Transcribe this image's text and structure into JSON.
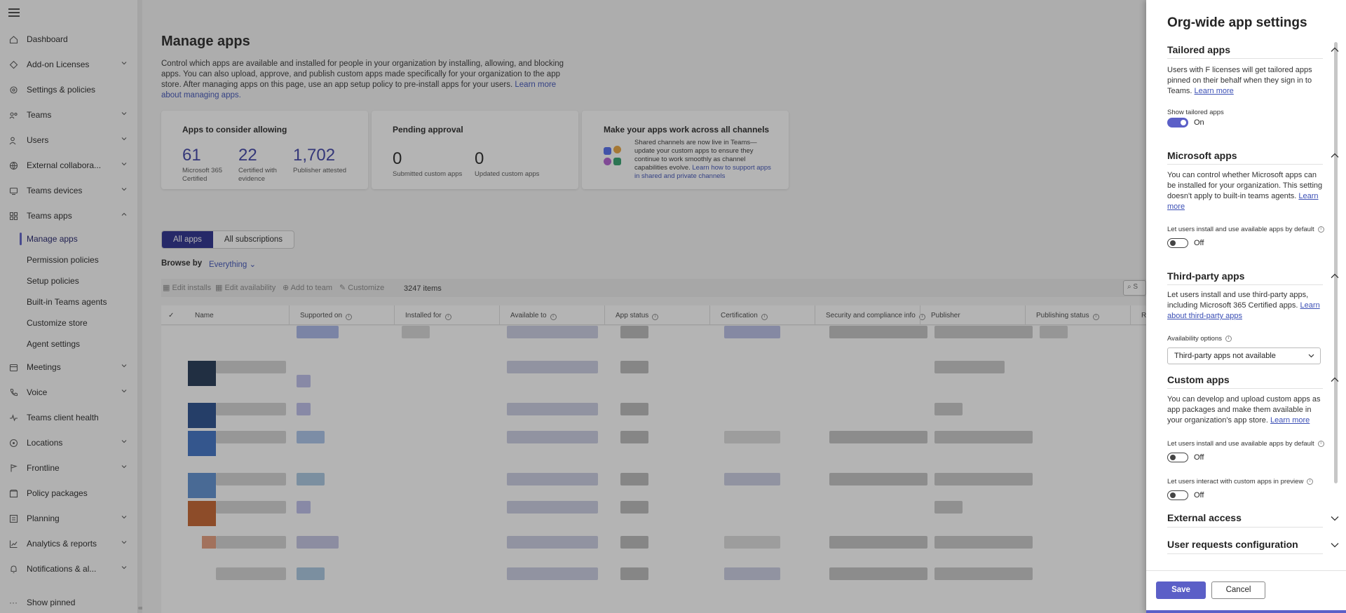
{
  "nav": {
    "items": [
      {
        "label": "Dashboard",
        "icon": "home-icon",
        "chevron": false
      },
      {
        "label": "Add-on Licenses",
        "icon": "diamond-icon",
        "chevron": true
      },
      {
        "label": "Settings & policies",
        "icon": "gear-icon",
        "chevron": false
      },
      {
        "label": "Teams",
        "icon": "teams-icon",
        "chevron": true
      },
      {
        "label": "Users",
        "icon": "users-icon",
        "chevron": true
      },
      {
        "label": "External collabora...",
        "icon": "globe-icon",
        "chevron": true
      },
      {
        "label": "Teams devices",
        "icon": "devices-icon",
        "chevron": true
      },
      {
        "label": "Teams apps",
        "icon": "apps-icon",
        "chevron": true
      }
    ],
    "sub_items": [
      "Manage apps",
      "Permission policies",
      "Setup policies",
      "Built-in Teams agents",
      "Customize store",
      "Agent settings"
    ],
    "items_after": [
      {
        "label": "Meetings",
        "icon": "calendar-icon"
      },
      {
        "label": "Voice",
        "icon": "phone-icon"
      },
      {
        "label": "Teams client health",
        "icon": "pulse-icon"
      },
      {
        "label": "Locations",
        "icon": "location-icon"
      },
      {
        "label": "Frontline",
        "icon": "frontline-icon"
      },
      {
        "label": "Policy packages",
        "icon": "package-icon"
      },
      {
        "label": "Planning",
        "icon": "planning-icon"
      },
      {
        "label": "Analytics & reports",
        "icon": "chart-icon"
      },
      {
        "label": "Notifications & al...",
        "icon": "bell-icon"
      }
    ],
    "show_pinned": "Show pinned"
  },
  "main": {
    "title": "Manage apps",
    "description": "Control which apps are available and installed for people in your organization by installing, allowing, and blocking apps. You can also upload, approve, and publish custom apps made specifically for your organization to the app store. After managing apps on this page, use an app setup policy to pre-install apps for your users.",
    "description_link": "Learn more about managing apps.",
    "card1": {
      "title": "Apps to consider allowing",
      "stats": [
        {
          "num": "61",
          "label": "Microsoft 365 Certified"
        },
        {
          "num": "22",
          "label": "Certified with evidence"
        },
        {
          "num": "1,702",
          "label": "Publisher attested"
        }
      ]
    },
    "card2": {
      "title": "Pending approval",
      "stats": [
        {
          "num": "0",
          "label": "Submitted custom apps"
        },
        {
          "num": "0",
          "label": "Updated custom apps"
        }
      ]
    },
    "card3": {
      "title": "Make your apps work across all channels",
      "text": "Shared channels are now live in Teams—update your custom apps to ensure they continue to work smoothly as channel capabilities evolve.",
      "link": "Learn how to support apps in shared and private channels"
    },
    "tabs": [
      "All apps",
      "All subscriptions"
    ],
    "browse_label": "Browse by",
    "browse_value": "Everything",
    "toolbar": [
      "Edit installs",
      "Edit availability",
      "Add to team",
      "Customize"
    ],
    "items_count": "3247 items",
    "search_stub": "S",
    "columns": [
      "Name",
      "Supported on",
      "Installed for",
      "Available to",
      "App status",
      "Certification",
      "Security and compliance info",
      "Publisher",
      "Publishing status",
      "Re"
    ]
  },
  "panel": {
    "title": "Org-wide app settings",
    "tailored": {
      "title": "Tailored apps",
      "text": "Users with F licenses will get tailored apps pinned on their behalf when they sign in to Teams.",
      "link": "Learn more",
      "field": "Show tailored apps",
      "state": "On"
    },
    "microsoft": {
      "title": "Microsoft apps",
      "text": "You can control whether Microsoft apps can be installed for your organization. This setting doesn't apply to built-in teams agents.",
      "link": "Learn more",
      "field": "Let users install and use available apps by default",
      "state": "Off"
    },
    "thirdparty": {
      "title": "Third-party apps",
      "text": "Let users install and use third-party apps, including Microsoft 365 Certified apps.",
      "link": "Learn about third-party apps",
      "field": "Availability options",
      "dropdown": "Third-party apps not available"
    },
    "custom": {
      "title": "Custom apps",
      "text": "You can develop and upload custom apps as app packages and make them available in your organization's app store.",
      "link": "Learn more",
      "field1": "Let users install and use available apps by default",
      "state1": "Off",
      "field2": "Let users interact with custom apps in preview",
      "state2": "Off"
    },
    "external": {
      "title": "External access"
    },
    "requests": {
      "title": "User requests configuration"
    },
    "save": "Save",
    "cancel": "Cancel"
  }
}
